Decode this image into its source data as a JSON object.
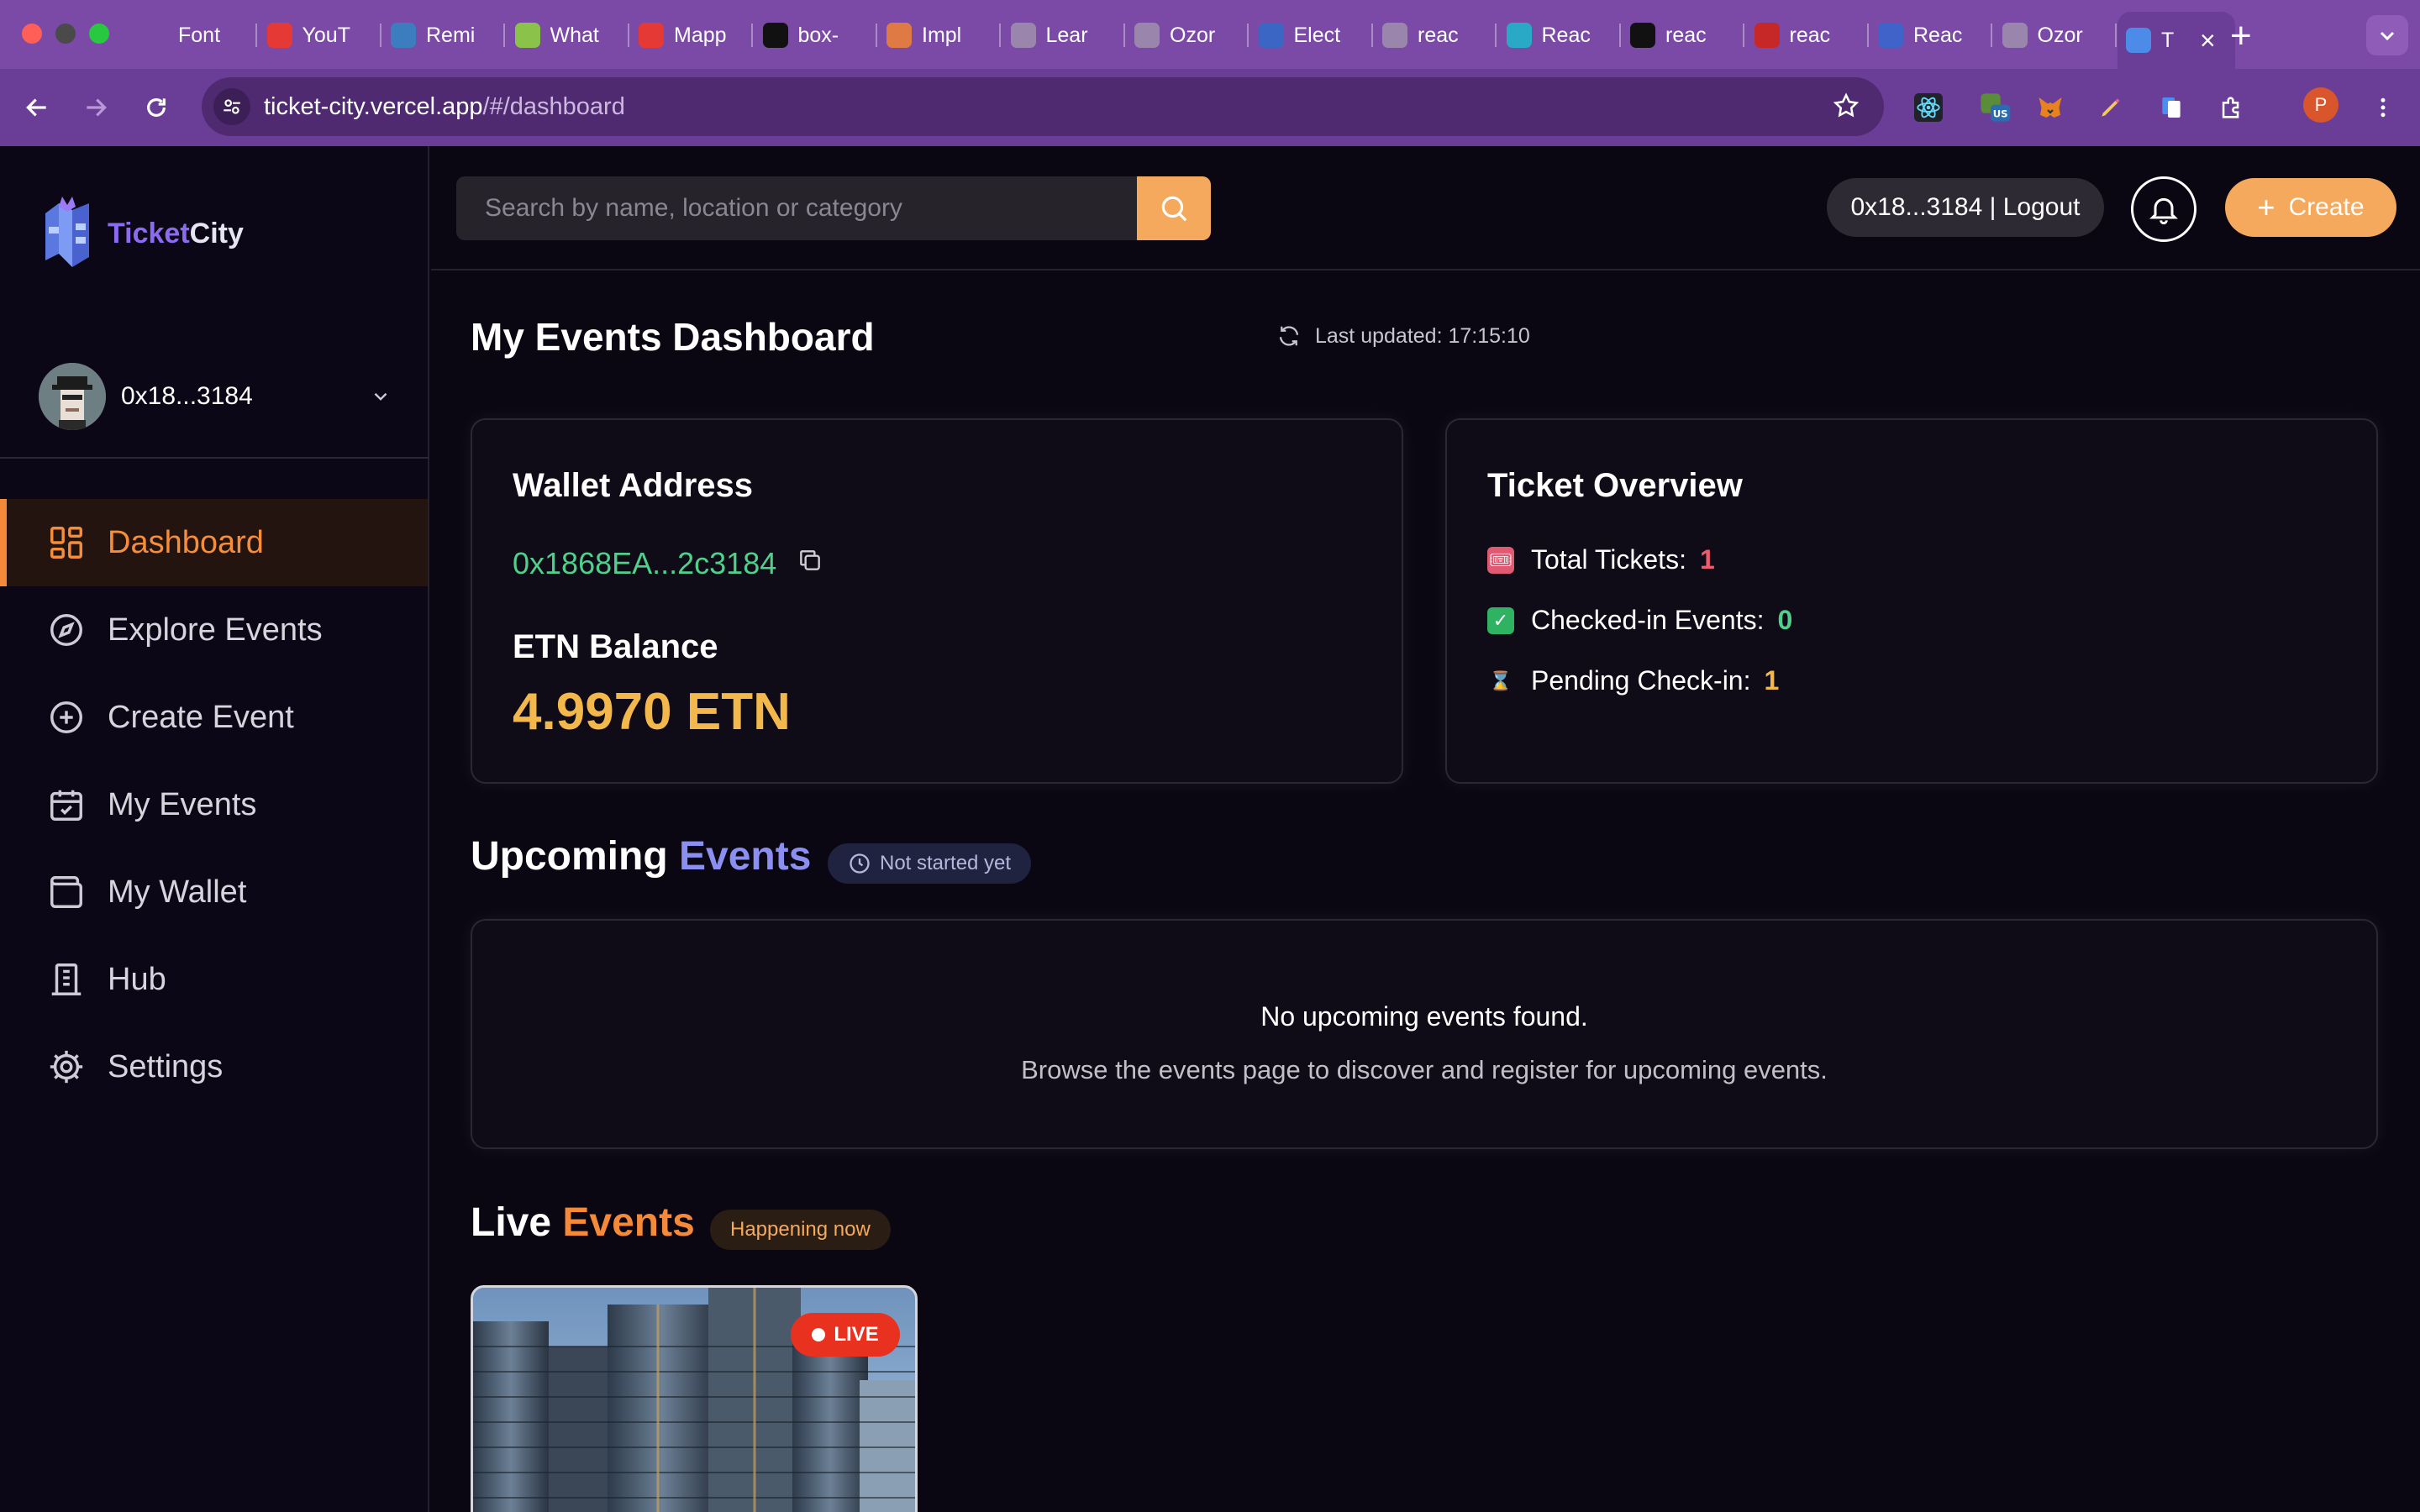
{
  "browser": {
    "tabs": [
      {
        "title": "Font",
        "icon": "document-icon",
        "color": "#7b4aa6"
      },
      {
        "title": "YouT",
        "icon": "youtube-icon",
        "color": "#e53935"
      },
      {
        "title": "Remi",
        "icon": "remix-icon",
        "color": "#3b7dbf"
      },
      {
        "title": "What",
        "icon": "ring-icon",
        "color": "#8bc34a"
      },
      {
        "title": "Mapp",
        "icon": "youtube-icon",
        "color": "#e53935"
      },
      {
        "title": "box-",
        "icon": "m-logo-icon",
        "color": "#111111"
      },
      {
        "title": "Impl",
        "icon": "sparkle-icon",
        "color": "#e07a45"
      },
      {
        "title": "Lear",
        "icon": "globe-icon",
        "color": "#9a86ad"
      },
      {
        "title": "Ozor",
        "icon": "globe-icon",
        "color": "#9a86ad"
      },
      {
        "title": "Elect",
        "icon": "electron-icon",
        "color": "#3b66c4"
      },
      {
        "title": "reac",
        "icon": "globe-icon",
        "color": "#9a86ad"
      },
      {
        "title": "Reac",
        "icon": "react-icon",
        "color": "#2aa9c6"
      },
      {
        "title": "reac",
        "icon": "github-icon",
        "color": "#111111"
      },
      {
        "title": "reac",
        "icon": "npm-icon",
        "color": "#c62828"
      },
      {
        "title": "Reac",
        "icon": "globe-icon",
        "color": "#3f63c9"
      },
      {
        "title": "Ozor",
        "icon": "globe-icon",
        "color": "#9a86ad"
      },
      {
        "title": "T",
        "icon": "ticketcity-icon",
        "color": "#4c8be8"
      }
    ],
    "url_host": "ticket-city.vercel.app",
    "url_path": "/#/dashboard",
    "profile_initial": "P"
  },
  "brand": {
    "name_part1": "Ticket",
    "name_part2": "City"
  },
  "user": {
    "short_address": "0x18...3184"
  },
  "nav": [
    {
      "label": "Dashboard",
      "icon": "dashboard-icon"
    },
    {
      "label": "Explore Events",
      "icon": "compass-icon"
    },
    {
      "label": "Create Event",
      "icon": "plus-circle-icon"
    },
    {
      "label": "My Events",
      "icon": "calendar-check-icon"
    },
    {
      "label": "My Wallet",
      "icon": "wallet-icon"
    },
    {
      "label": "Hub",
      "icon": "building-icon"
    },
    {
      "label": "Settings",
      "icon": "gear-icon"
    }
  ],
  "header": {
    "search_placeholder": "Search by name, location or category",
    "wallet_label": "0x18...3184 | Logout",
    "create_label": "Create"
  },
  "dashboard": {
    "title": "My Events Dashboard",
    "last_updated": "Last updated: 17:15:10",
    "wallet": {
      "title": "Wallet Address",
      "address": "0x1868EA...2c3184",
      "balance_title": "ETN Balance",
      "balance": "4.9970 ETN"
    },
    "tickets": {
      "title": "Ticket Overview",
      "rows": [
        {
          "emoji": "ticket-icon",
          "label": "Total Tickets:",
          "value": "1",
          "color": "#ef5b6e"
        },
        {
          "emoji": "check-icon",
          "label": "Checked-in Events:",
          "value": "0",
          "color": "#4fd18b"
        },
        {
          "emoji": "hourglass-icon",
          "label": "Pending Check-in:",
          "value": "1",
          "color": "#f2b84b"
        }
      ]
    },
    "upcoming": {
      "title_part1": "Upcoming",
      "title_part2": "Events",
      "accent": "#8b8ff0",
      "badge": "Not started yet",
      "empty_title": "No upcoming events found.",
      "empty_sub": "Browse the events page to discover and register for upcoming events."
    },
    "live": {
      "title_part1": "Live",
      "title_part2": "Events",
      "accent": "#f5893a",
      "badge": "Happening now",
      "live_label": "LIVE"
    }
  },
  "colors": {
    "accent_orange": "#f5a95c",
    "bg": "#0a0612",
    "chrome": "#7b4aa6"
  }
}
